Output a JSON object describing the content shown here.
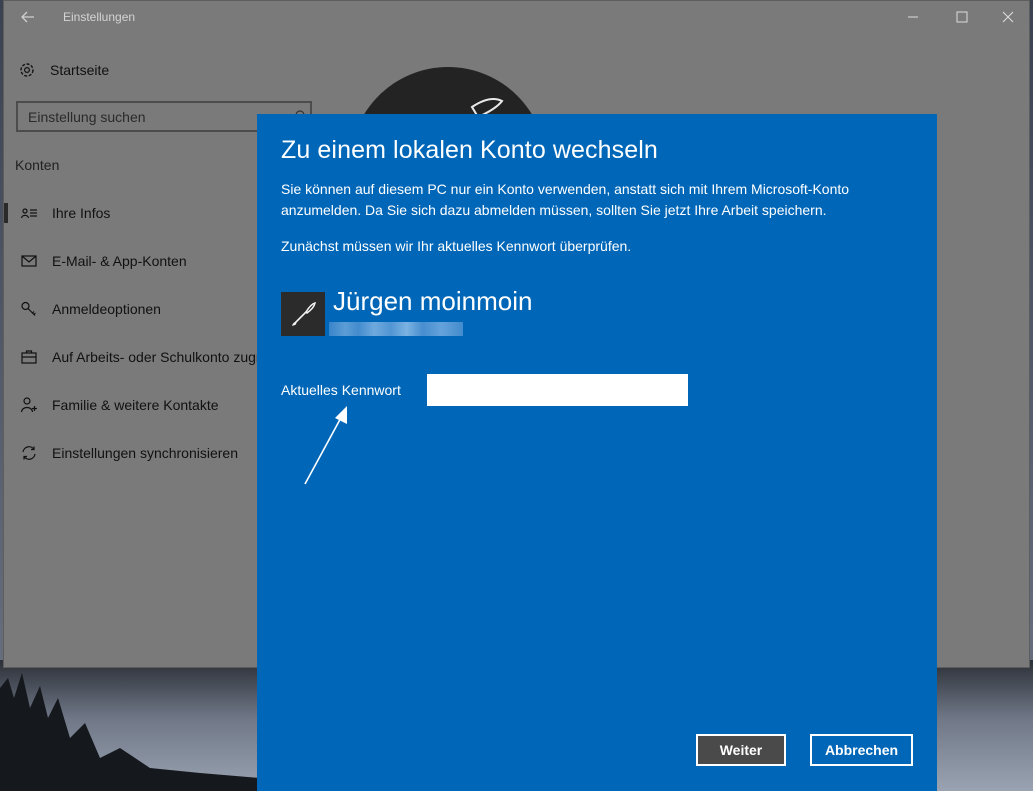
{
  "window": {
    "title": "Einstellungen"
  },
  "sidebar": {
    "home_label": "Startseite",
    "search_placeholder": "Einstellung suchen",
    "section_label": "Konten",
    "items": [
      {
        "label": "Ihre Infos",
        "icon": "contact-card-icon",
        "selected": true
      },
      {
        "label": "E-Mail- & App-Konten",
        "icon": "mail-icon",
        "selected": false
      },
      {
        "label": "Anmeldeoptionen",
        "icon": "key-icon",
        "selected": false
      },
      {
        "label": "Auf Arbeits- oder Schulkonto zugreifen",
        "icon": "briefcase-icon",
        "selected": false
      },
      {
        "label": "Familie & weitere Kontakte",
        "icon": "person-add-icon",
        "selected": false
      },
      {
        "label": "Einstellungen synchronisieren",
        "icon": "sync-icon",
        "selected": false
      }
    ]
  },
  "dialog": {
    "title": "Zu einem lokalen Konto wechseln",
    "description": "Sie können auf diesem PC nur ein Konto verwenden, anstatt sich mit Ihrem Microsoft-Konto anzumelden. Da Sie sich dazu abmelden müssen, sollten Sie jetzt Ihre Arbeit speichern.",
    "note": "Zunächst müssen wir Ihr aktuelles Kennwort überprüfen.",
    "user_name": "Jürgen moinmoin",
    "password_label": "Aktuelles Kennwort",
    "password_value": "",
    "next_label": "Weiter",
    "cancel_label": "Abbrechen"
  },
  "colors": {
    "dialog_bg": "#0067b8",
    "settings_dimmed_bg": "#7a7a7a",
    "next_button_bg": "#4a4a4a"
  }
}
